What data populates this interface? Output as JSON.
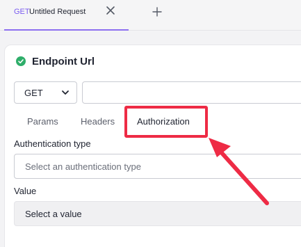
{
  "tab": {
    "method": "GET",
    "title": "Untitled Request"
  },
  "panel": {
    "heading": "Endpoint Url",
    "method_value": "GET",
    "url_value": "",
    "subtabs": [
      "Params",
      "Headers",
      "Authorization"
    ],
    "auth_label": "Authentication type",
    "auth_placeholder": "Select an authentication type",
    "value_label": "Value",
    "value_placeholder": "Select a value"
  },
  "colors": {
    "accent": "#8d6ff0",
    "success": "#2fae6a",
    "highlight": "#ee2b45"
  }
}
